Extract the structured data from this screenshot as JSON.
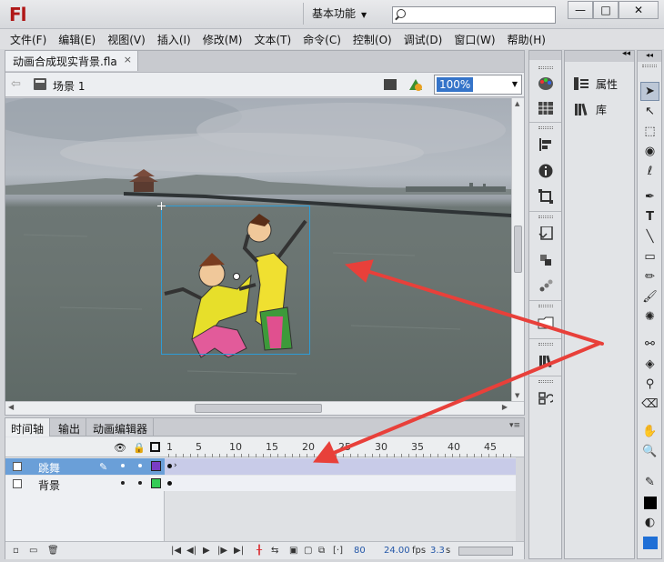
{
  "app": {
    "logo": "Fl",
    "workspace": "基本功能",
    "search_placeholder": "",
    "window_buttons": [
      "—",
      "□",
      "✕"
    ]
  },
  "menu": [
    "文件(F)",
    "编辑(E)",
    "视图(V)",
    "插入(I)",
    "修改(M)",
    "文本(T)",
    "命令(C)",
    "控制(O)",
    "调试(D)",
    "窗口(W)",
    "帮助(H)"
  ],
  "document": {
    "tab_name": "动画合成现实背景.fla",
    "tab_close": "×",
    "scene_label": "场景 1",
    "zoom": "100%"
  },
  "timeline": {
    "tabs": [
      "时间轴",
      "输出",
      "动画编辑器"
    ],
    "ruler_labels": [
      "1",
      "5",
      "10",
      "15",
      "20",
      "25",
      "30",
      "35",
      "40",
      "45"
    ],
    "layers": [
      {
        "name": "跳舞",
        "selected": true,
        "color": "#7a3dc4"
      },
      {
        "name": "背景",
        "selected": false,
        "color": "#33cc55"
      }
    ],
    "footer": {
      "current_frame": "80",
      "fps": "24.00",
      "fps_unit": "fps",
      "time": "3.3",
      "time_unit": "s"
    }
  },
  "properties_panel": {
    "items": [
      "属性",
      "库"
    ]
  },
  "colors": {
    "accent": "#3574c9",
    "selection_row": "#6a9fd8",
    "arrow": "#e8403a",
    "logo": "#b01818"
  }
}
